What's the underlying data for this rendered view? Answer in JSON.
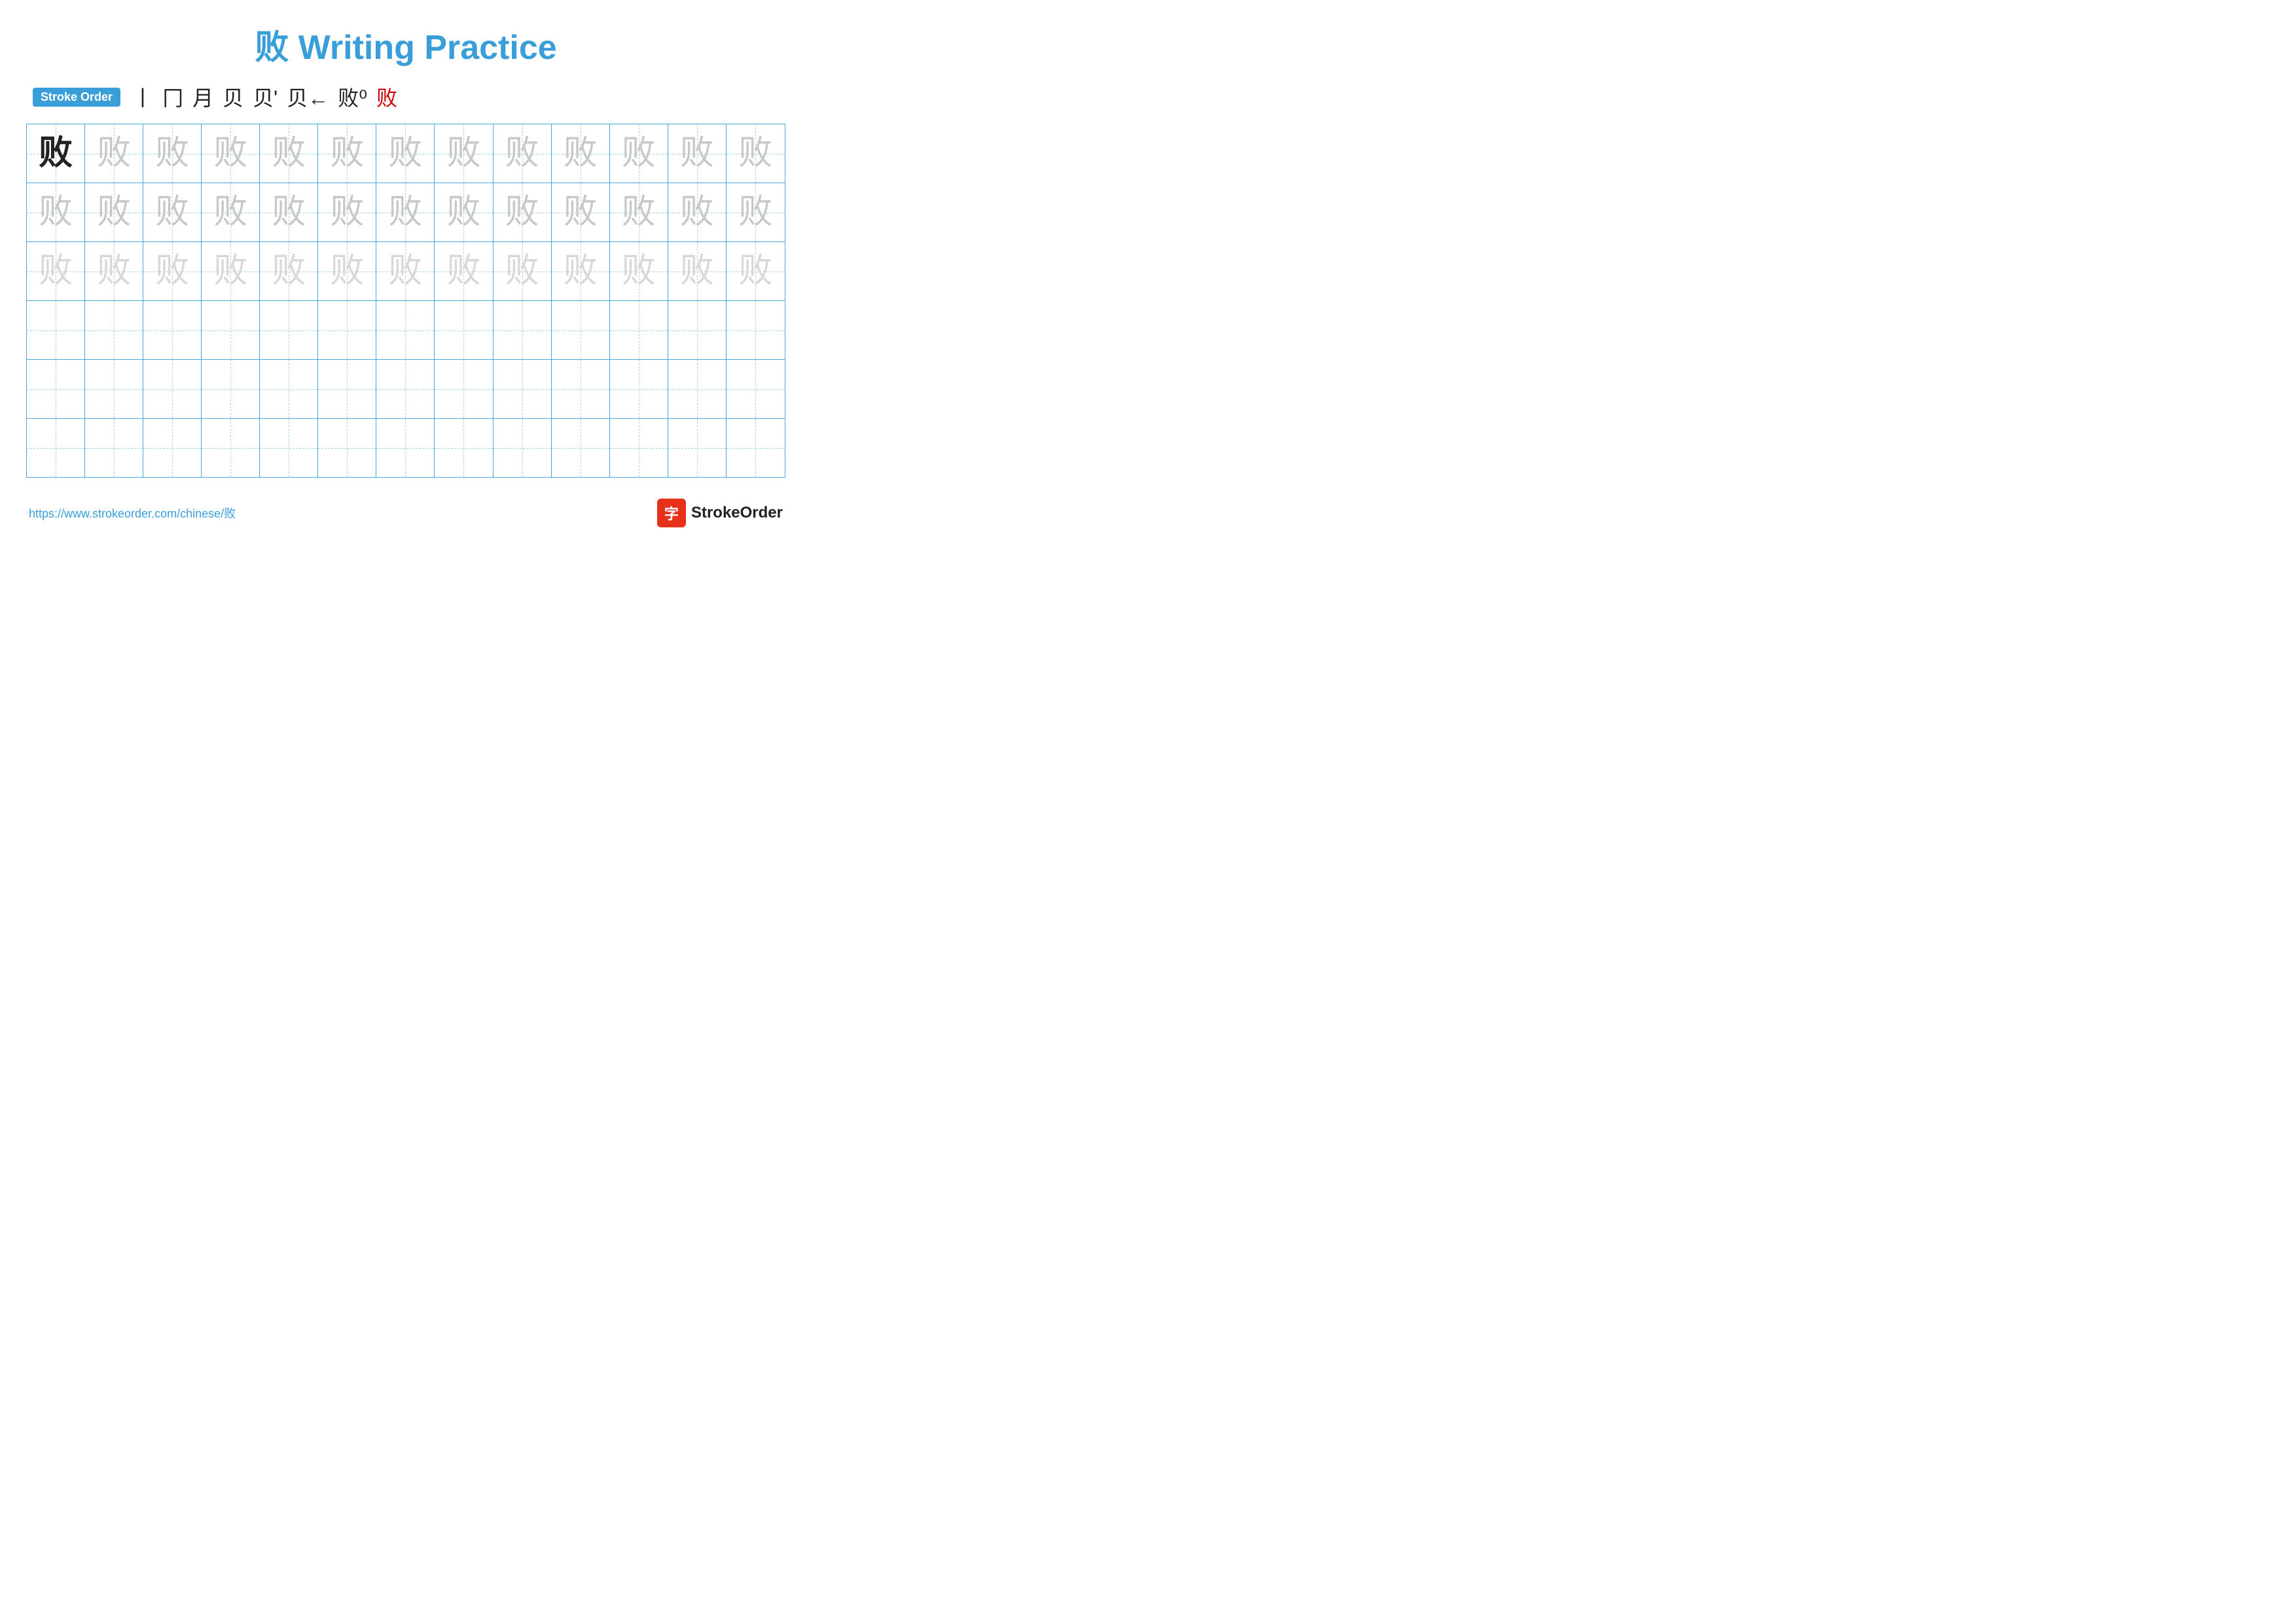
{
  "title": {
    "text": "败 Writing Practice"
  },
  "stroke_order": {
    "badge_label": "Stroke Order",
    "strokes": [
      "丨",
      "冂",
      "月",
      "贝",
      "贝'",
      "贝←",
      "败⁰",
      "败"
    ]
  },
  "grid": {
    "rows": 6,
    "cols": 13,
    "char": "败",
    "row1": [
      "dark",
      "medium",
      "medium",
      "medium",
      "medium",
      "medium",
      "medium",
      "medium",
      "medium",
      "medium",
      "medium",
      "medium",
      "medium"
    ],
    "row2": [
      "medium",
      "medium",
      "medium",
      "medium",
      "medium",
      "medium",
      "medium",
      "medium",
      "medium",
      "medium",
      "medium",
      "medium",
      "medium"
    ],
    "row3": [
      "light",
      "light",
      "light",
      "light",
      "light",
      "light",
      "light",
      "light",
      "light",
      "light",
      "light",
      "light",
      "light"
    ],
    "row4": [
      "empty",
      "empty",
      "empty",
      "empty",
      "empty",
      "empty",
      "empty",
      "empty",
      "empty",
      "empty",
      "empty",
      "empty",
      "empty"
    ],
    "row5": [
      "empty",
      "empty",
      "empty",
      "empty",
      "empty",
      "empty",
      "empty",
      "empty",
      "empty",
      "empty",
      "empty",
      "empty",
      "empty"
    ],
    "row6": [
      "empty",
      "empty",
      "empty",
      "empty",
      "empty",
      "empty",
      "empty",
      "empty",
      "empty",
      "empty",
      "empty",
      "empty",
      "empty"
    ]
  },
  "footer": {
    "url": "https://www.strokeorder.com/chinese/败",
    "logo_icon": "字",
    "logo_text": "StrokeOrder"
  }
}
